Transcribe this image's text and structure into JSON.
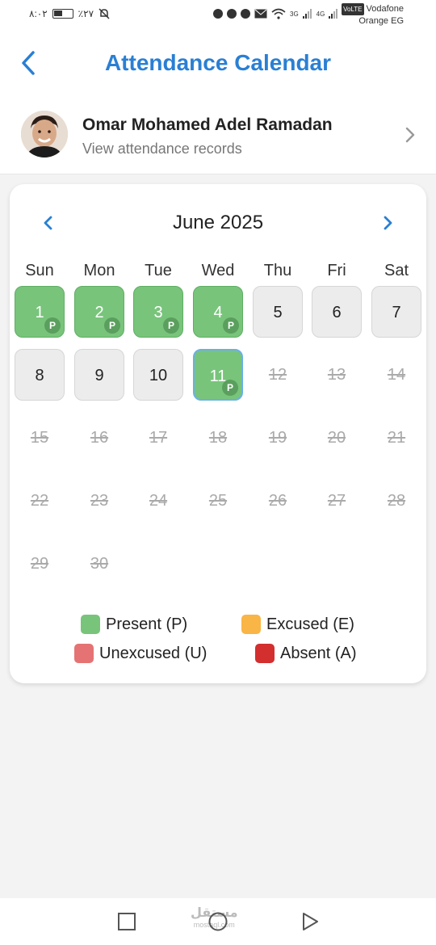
{
  "status_bar": {
    "time": "٨:٠٢",
    "battery": "٪٢٧",
    "network_3g": "3G",
    "network_4g": "4G",
    "volte": "VoLTE",
    "carrier_line1": "Vodafone",
    "carrier_line2": "Orange EG"
  },
  "header": {
    "title": "Attendance Calendar"
  },
  "profile": {
    "name": "Omar Mohamed Adel Ramadan",
    "subtitle": "View attendance records"
  },
  "calendar": {
    "month_label": "June 2025",
    "weekdays": [
      "Sun",
      "Mon",
      "Tue",
      "Wed",
      "Thu",
      "Fri",
      "Sat"
    ],
    "days": [
      {
        "n": "1",
        "state": "present",
        "badge": "P"
      },
      {
        "n": "2",
        "state": "present",
        "badge": "P"
      },
      {
        "n": "3",
        "state": "present",
        "badge": "P"
      },
      {
        "n": "4",
        "state": "present",
        "badge": "P"
      },
      {
        "n": "5",
        "state": "normal"
      },
      {
        "n": "6",
        "state": "normal"
      },
      {
        "n": "7",
        "state": "normal"
      },
      {
        "n": "8",
        "state": "normal"
      },
      {
        "n": "9",
        "state": "normal"
      },
      {
        "n": "10",
        "state": "normal"
      },
      {
        "n": "11",
        "state": "present-today",
        "badge": "P"
      },
      {
        "n": "12",
        "state": "future"
      },
      {
        "n": "13",
        "state": "future"
      },
      {
        "n": "14",
        "state": "future"
      },
      {
        "n": "15",
        "state": "future"
      },
      {
        "n": "16",
        "state": "future"
      },
      {
        "n": "17",
        "state": "future"
      },
      {
        "n": "18",
        "state": "future"
      },
      {
        "n": "19",
        "state": "future"
      },
      {
        "n": "20",
        "state": "future"
      },
      {
        "n": "21",
        "state": "future"
      },
      {
        "n": "22",
        "state": "future"
      },
      {
        "n": "23",
        "state": "future"
      },
      {
        "n": "24",
        "state": "future"
      },
      {
        "n": "25",
        "state": "future"
      },
      {
        "n": "26",
        "state": "future"
      },
      {
        "n": "27",
        "state": "future"
      },
      {
        "n": "28",
        "state": "future"
      },
      {
        "n": "29",
        "state": "future"
      },
      {
        "n": "30",
        "state": "future"
      }
    ]
  },
  "legend": [
    {
      "label": "Present (P)",
      "color": "#78c47b"
    },
    {
      "label": "Excused (E)",
      "color": "#f9b545"
    },
    {
      "label": "Unexcused (U)",
      "color": "#e57373"
    },
    {
      "label": "Absent (A)",
      "color": "#d32f2f"
    }
  ],
  "colors": {
    "accent": "#2a7fd4",
    "present": "#78c47b"
  },
  "watermark": {
    "text": "مستقل",
    "sub": "mostaql.com"
  }
}
